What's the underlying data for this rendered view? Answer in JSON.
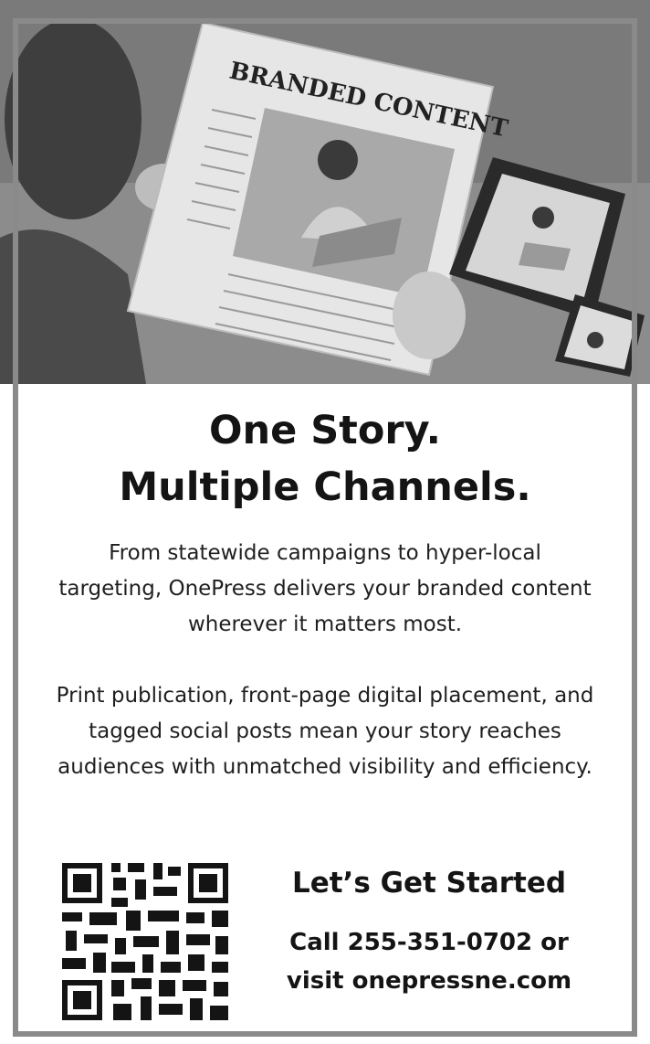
{
  "photo": {
    "newspaper_masthead": "BRANDED CONTENT",
    "alt_subject": "person-reading-newspaper-with-tablet-and-phone"
  },
  "headline": {
    "line1": "One Story.",
    "line2": "Multiple Channels."
  },
  "body": {
    "paragraph1": "From statewide campaigns to hyper-local targeting, OnePress delivers your branded content wherever it matters most.",
    "paragraph2": "Print publication, front-page digital placement, and tagged social posts mean your story reaches audiences with unmatched visibility and efficiency."
  },
  "cta": {
    "title": "Let’s Get Started",
    "line1": "Call 255-351-0702 or",
    "line2": "visit onepressne.com"
  },
  "colors": {
    "frame": "#8a8a8a",
    "text": "#141414",
    "background": "#ffffff"
  },
  "icons": {
    "qr": "qr-code-icon"
  }
}
